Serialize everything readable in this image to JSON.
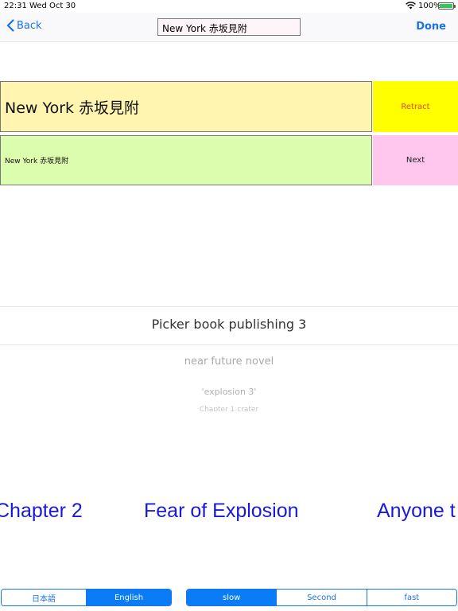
{
  "status_bar": {
    "time": "22:31",
    "date": "Wed Oct 30",
    "battery_percent": "100%",
    "battery_level": 1.0,
    "wifi_icon": "wifi-icon",
    "battery_icon": "battery-icon"
  },
  "nav": {
    "back_label": "Back",
    "title_value": "New York 赤坂見附",
    "done_label": "Done"
  },
  "rows": {
    "large_text": "New York 赤坂見附",
    "retract_label": "Retract",
    "small_text": "New York 赤坂見附",
    "next_label": "Next"
  },
  "picker": {
    "selected": "Picker book publishing 3",
    "items": [
      "near future novel",
      "'explosion 3'",
      "Chapter 1 crater"
    ]
  },
  "marquee": {
    "items": [
      "Chapter 2",
      "Fear of Explosion",
      "Anyone t"
    ]
  },
  "language_segments": {
    "options": [
      "日本語",
      "English"
    ],
    "selected": "English"
  },
  "speed_segments": {
    "options": [
      "slow",
      "Second",
      "fast"
    ],
    "selected": "slow"
  },
  "colors": {
    "accent": "#1a73e8",
    "large_box_bg": "#fff5b1",
    "small_box_bg": "#dcfcae",
    "retract_bg": "#ffff00",
    "retract_text": "#e8452e",
    "next_bg": "#ffc6ee",
    "marquee_text": "#1a1ad6"
  }
}
